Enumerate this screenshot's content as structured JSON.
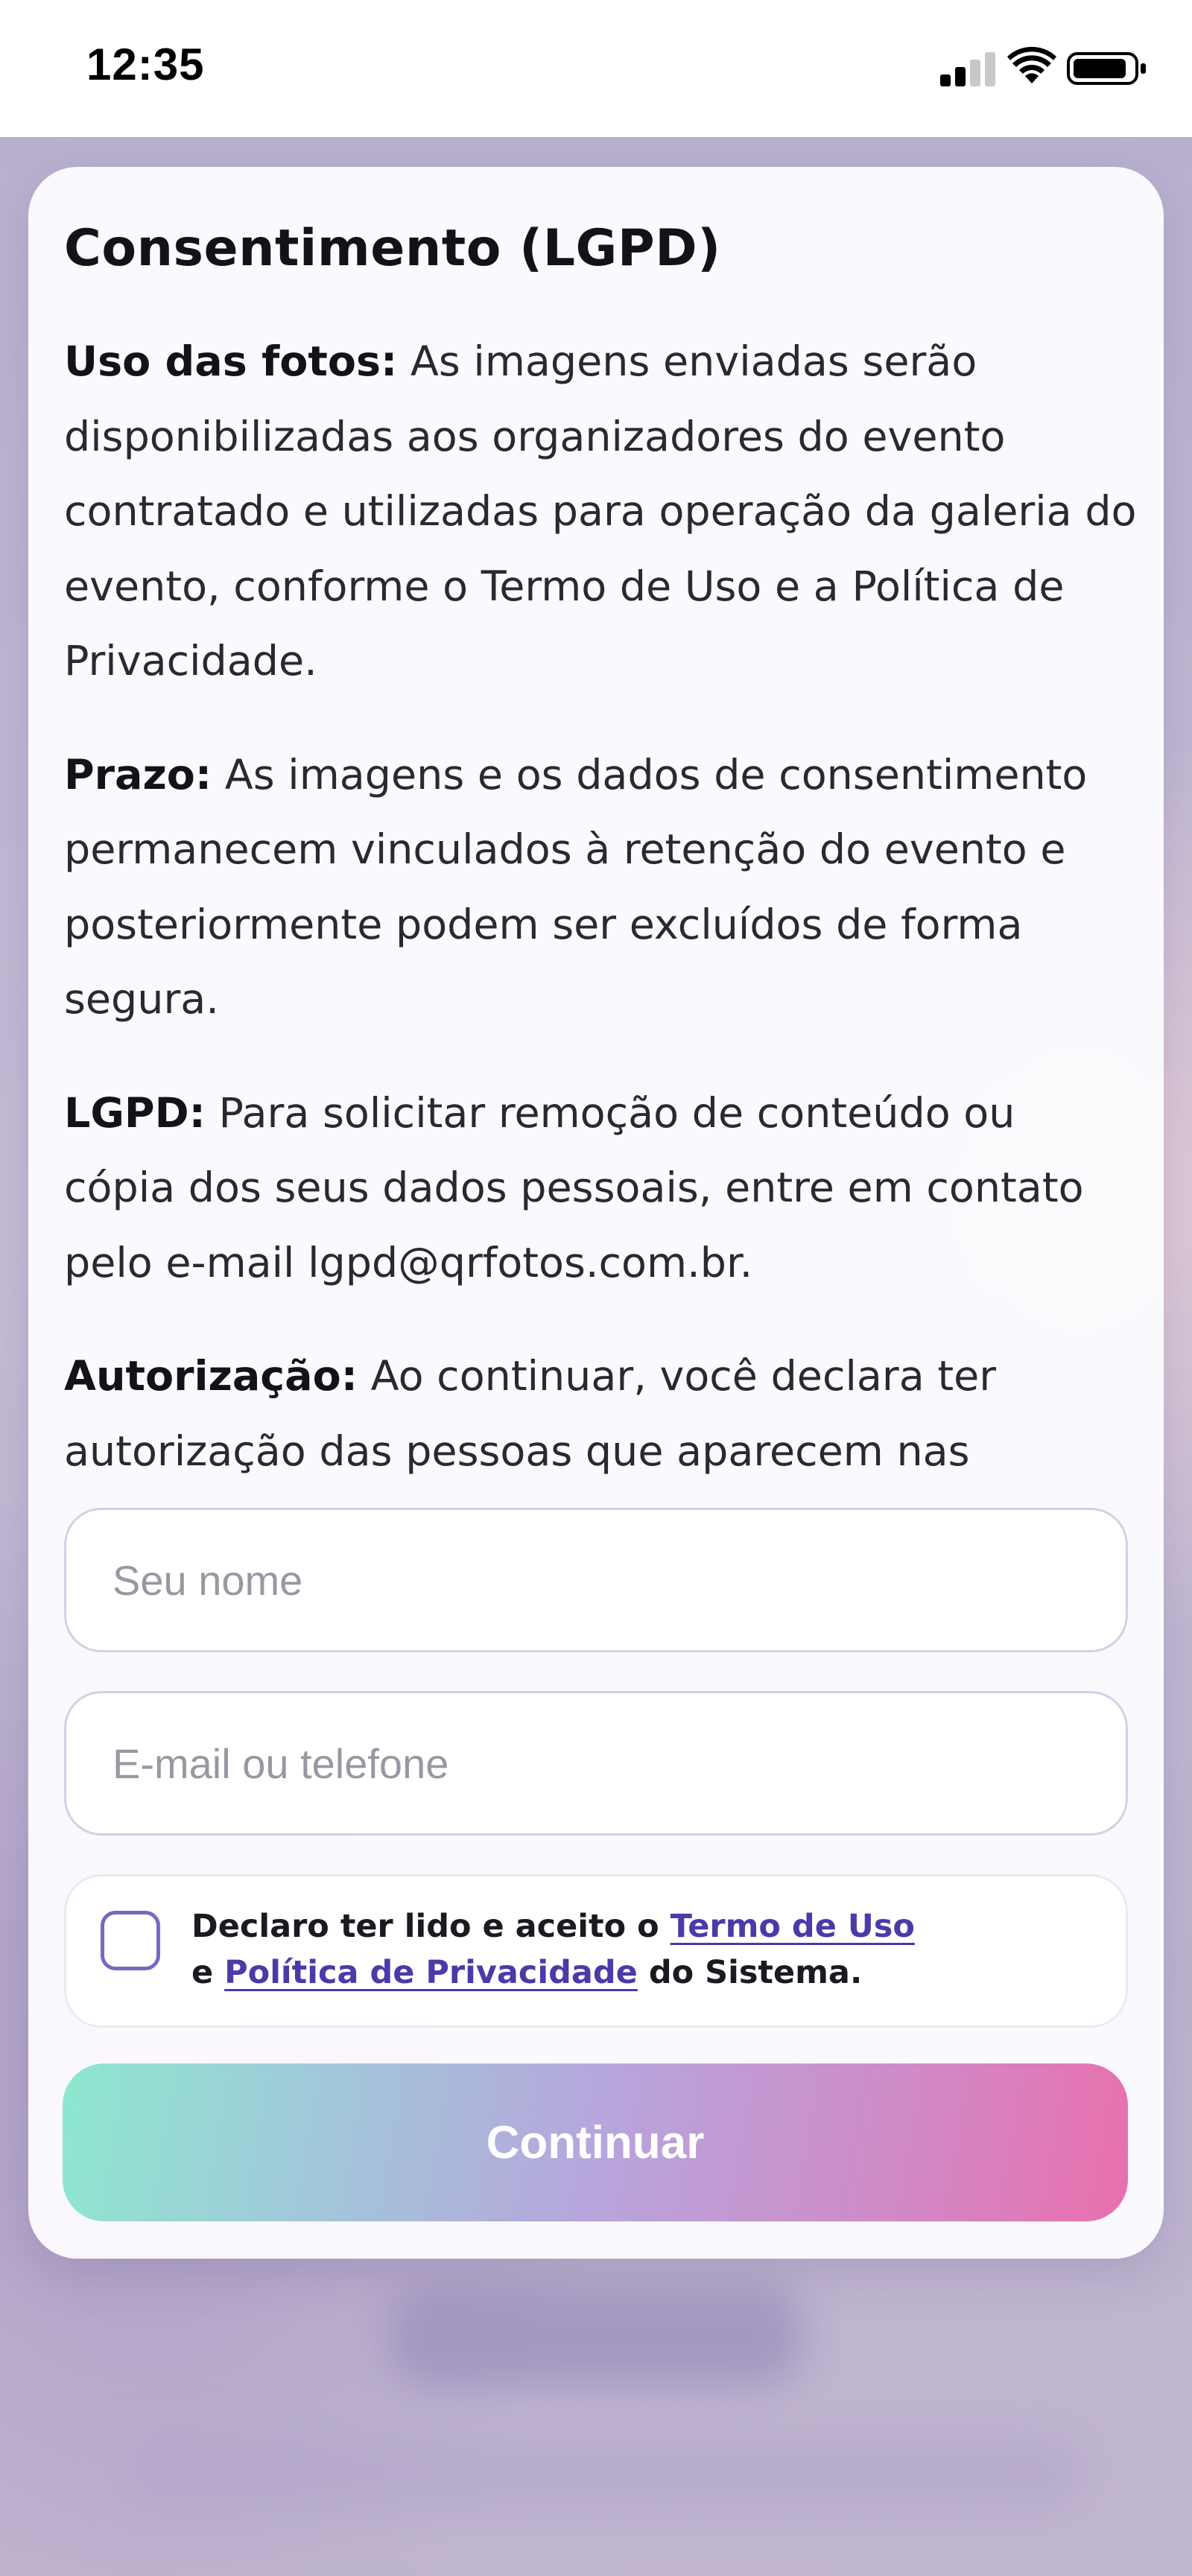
{
  "status_bar": {
    "time": "12:35"
  },
  "consent": {
    "title": "Consentimento (LGPD)",
    "sections": [
      {
        "label": "Uso das fotos:",
        "text": " As imagens enviadas serão disponibilizadas aos organizadores do evento contratado e utilizadas para operação da galeria do evento, conforme o Termo de Uso e a Política de Privacidade."
      },
      {
        "label": "Prazo:",
        "text": " As imagens e os dados de consentimento permanecem vinculados à retenção do evento e posteriormente podem ser excluídos de forma segura."
      },
      {
        "label": "LGPD:",
        "text": " Para solicitar remoção de conteúdo ou cópia dos seus dados pessoais, entre em contato pelo e-mail lgpd@qrfotos.com.br."
      },
      {
        "label": "Autorização:",
        "text": " Ao continuar, você declara ter autorização das pessoas que aparecem nas"
      }
    ]
  },
  "form": {
    "name_placeholder": "Seu nome",
    "name_value": "",
    "contact_placeholder": "E-mail ou telefone",
    "contact_value": "",
    "checkbox_checked": false,
    "checkbox_text_1": "Declaro ter lido e aceito o ",
    "terms_link": "Termo de Uso",
    "checkbox_text_2": "e ",
    "privacy_link": "Política de Privacidade",
    "checkbox_text_3": " do Sistema.",
    "continue_label": "Continuar"
  },
  "colors": {
    "accent": "#4b3aa8",
    "checkbox_border": "#7a68c0",
    "button_gradient_start": "#8ee8cf",
    "button_gradient_end": "#ea6fad"
  }
}
